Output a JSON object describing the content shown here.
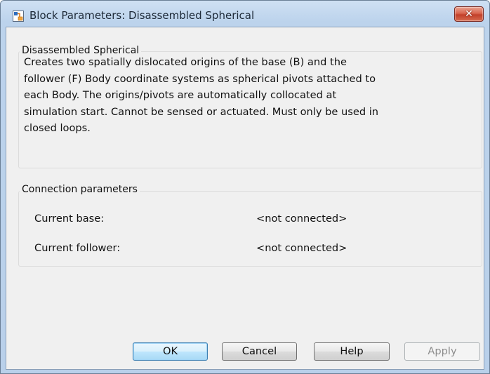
{
  "window": {
    "title": "Block Parameters: Disassembled Spherical",
    "close_glyph": "✕",
    "icon": "simulink-block-icon"
  },
  "description_group": {
    "legend": "Disassembled Spherical",
    "lines": [
      "Creates two spatially dislocated origins of the base (B) and the",
      "follower (F) Body coordinate systems as spherical pivots attached to",
      "each Body. The origins/pivots are automatically collocated at",
      "simulation start. Cannot be sensed or actuated. Must only be used in",
      "closed loops."
    ]
  },
  "connection_group": {
    "legend": "Connection parameters",
    "base_label": "Current base:",
    "base_value": "<not connected>",
    "follower_label": "Current follower:",
    "follower_value": "<not connected>"
  },
  "buttons": {
    "ok": "OK",
    "cancel": "Cancel",
    "help": "Help",
    "apply": "Apply"
  },
  "colors": {
    "title_bar": "#bcd3ec",
    "close_button": "#c2402a",
    "dialog_background": "#f0f0f0",
    "default_button_border": "#3c7fb1"
  }
}
